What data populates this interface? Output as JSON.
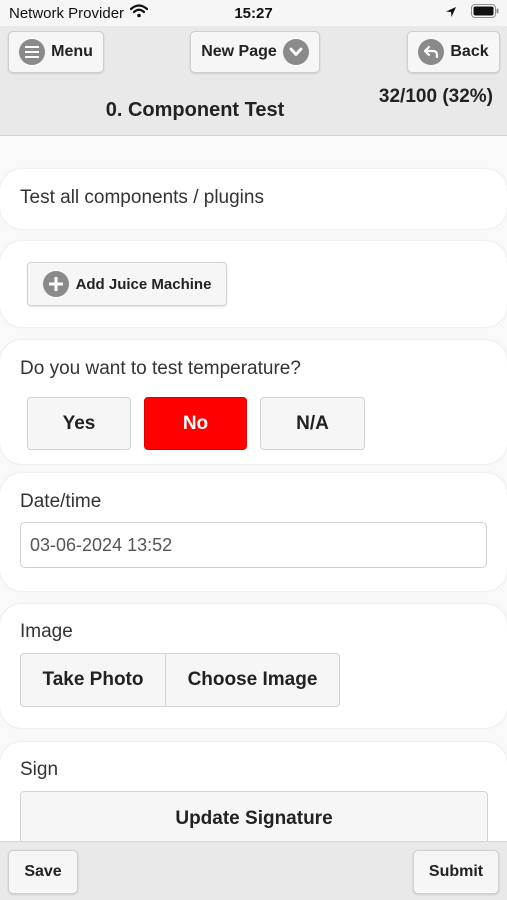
{
  "status_bar": {
    "carrier": "Network Provider",
    "time": "15:27",
    "icons": [
      "wifi-icon",
      "location-arrow-icon",
      "battery-icon"
    ]
  },
  "header": {
    "menu_label": "Menu",
    "new_page_label": "New Page",
    "back_label": "Back",
    "title": "0. Component Test",
    "progress": "32/100 (32%)"
  },
  "sections": {
    "intro_text": "Test all components / plugins",
    "add_button_label": "Add Juice Machine",
    "temperature": {
      "question": "Do you want to test temperature?",
      "options": [
        "Yes",
        "No",
        "N/A"
      ],
      "selected": "No"
    },
    "datetime": {
      "label": "Date/time",
      "value": "03-06-2024 13:52"
    },
    "image": {
      "label": "Image",
      "take_photo_label": "Take Photo",
      "choose_image_label": "Choose Image"
    },
    "sign": {
      "label": "Sign",
      "update_label": "Update Signature"
    }
  },
  "footer": {
    "save_label": "Save",
    "submit_label": "Submit"
  },
  "colors": {
    "selected_red": "#fe0000",
    "header_bg": "#e9e9e9",
    "icon_gray": "#8a8a8a"
  }
}
